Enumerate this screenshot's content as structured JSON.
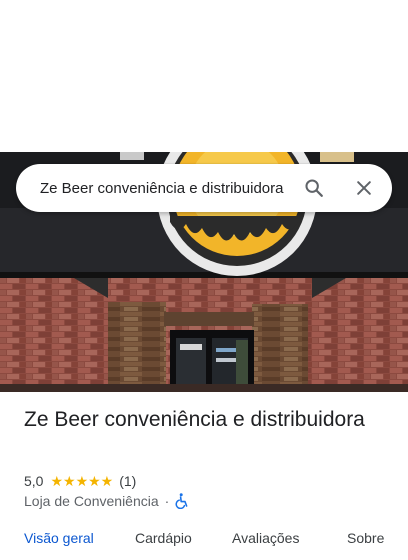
{
  "search": {
    "query": "Ze Beer conveniência e distribuidora",
    "search_icon": "search-icon",
    "clear_icon": "close-icon"
  },
  "place": {
    "name": "Ze Beer conveniência e distribuidora",
    "rating": "5,0",
    "stars": 5,
    "review_count": "(1)",
    "category": "Loja de Conveniência",
    "separator": "·",
    "accessibility_icon": "wheelchair-icon"
  },
  "tabs": [
    {
      "label": "Visão geral",
      "active": true
    },
    {
      "label": "Cardápio",
      "active": false
    },
    {
      "label": "Avaliações",
      "active": false
    },
    {
      "label": "Sobre",
      "active": false
    }
  ],
  "colors": {
    "accent": "#0b57d0",
    "star": "#f4b400",
    "text": "#202124",
    "secondary_text": "#5f6368"
  }
}
